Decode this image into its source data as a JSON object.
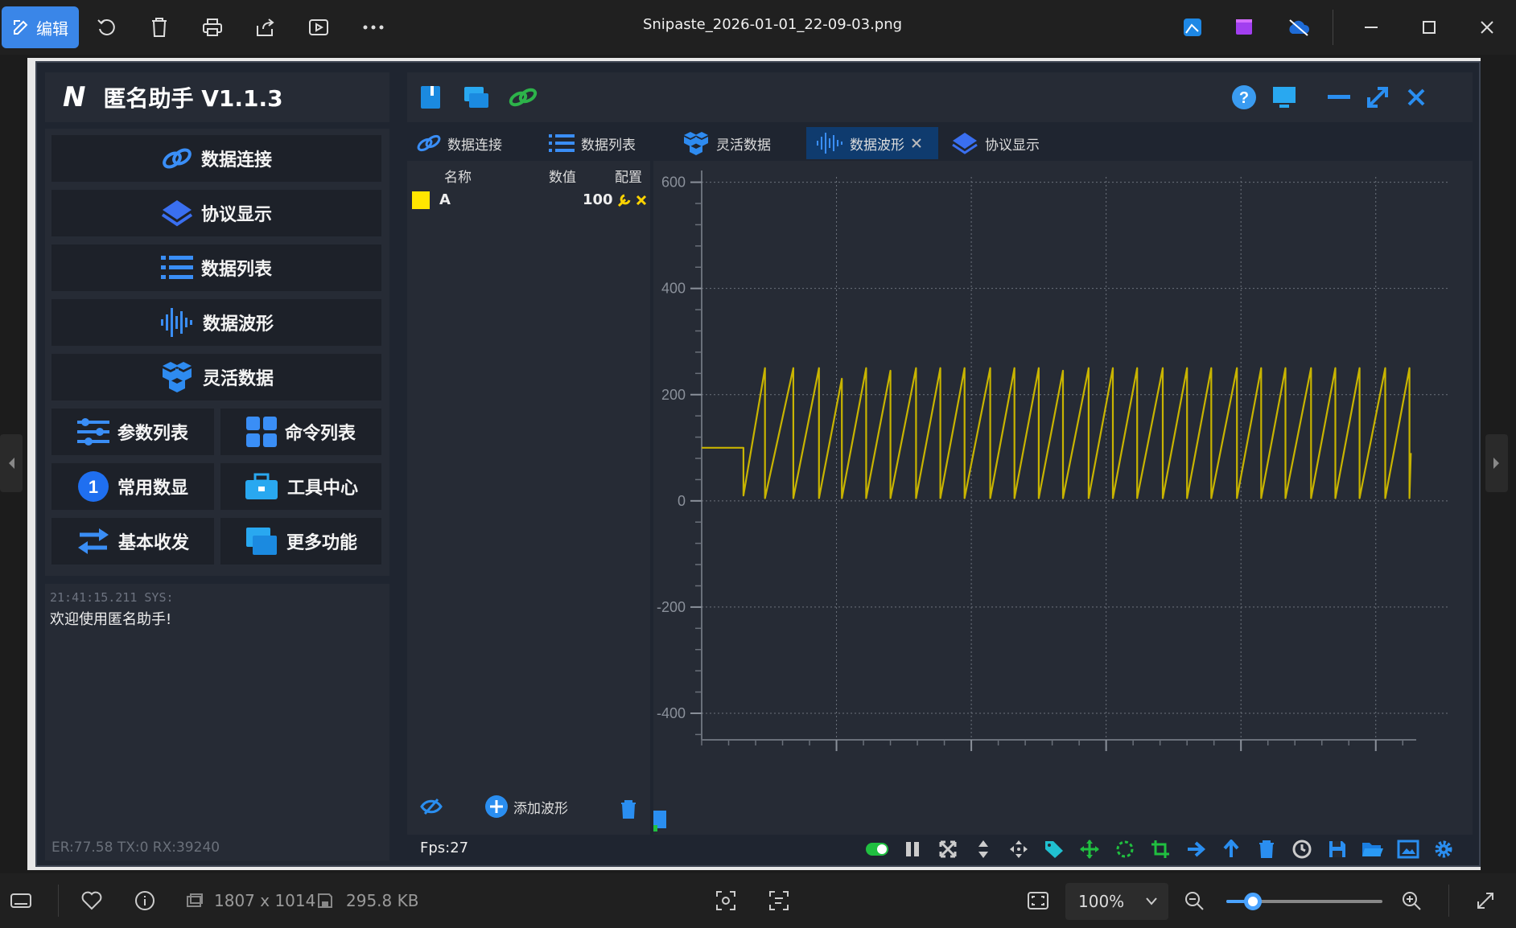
{
  "viewer": {
    "edit_label": "编辑",
    "filename": "Snipaste_2026-01-01_22-09-03.png",
    "dimensions": "1807 x 1014",
    "filesize": "295.8 KB",
    "zoom": "100%",
    "zoom_slider_fraction": 0.17,
    "accent": "#3a86e8"
  },
  "app": {
    "logo": "N",
    "title": "匿名助手  V1.1.3",
    "menu": {
      "connect": "数据连接",
      "protocol": "协议显示",
      "list": "数据列表",
      "wave": "数据波形",
      "flex": "灵活数据",
      "params": "参数列表",
      "commands": "命令列表",
      "common": "常用数显",
      "tools": "工具中心",
      "basic": "基本收发",
      "more": "更多功能"
    },
    "log": {
      "time": "21:41:15.211 SYS:",
      "message": "欢迎使用匿名助手!",
      "status": "ER:77.58 TX:0 RX:39240"
    },
    "tabs": [
      {
        "label": "数据连接"
      },
      {
        "label": "数据列表"
      },
      {
        "label": "灵活数据"
      },
      {
        "label": "数据波形"
      },
      {
        "label": "协议显示"
      }
    ],
    "list": {
      "col_name": "名称",
      "col_value": "数值",
      "col_config": "配置",
      "rows": [
        {
          "name": "A",
          "value": "100",
          "color": "#ffe600"
        }
      ],
      "add_wave": "添加波形"
    },
    "fps": "Fps:27"
  },
  "chart_data": {
    "type": "line",
    "series": [
      {
        "name": "A",
        "color": "#c8b400",
        "x": [
          0,
          31,
          31,
          47,
          47,
          68,
          68,
          87,
          87,
          104,
          104,
          122,
          122,
          140,
          140,
          159,
          159,
          177,
          177,
          195,
          195,
          214,
          214,
          232,
          232,
          250,
          250,
          268,
          268,
          287,
          287,
          305,
          305,
          323,
          323,
          342,
          342,
          360,
          360,
          378,
          378,
          397,
          397,
          415,
          415,
          433,
          433,
          452,
          452,
          470,
          470,
          488,
          488,
          507,
          507,
          525,
          525,
          526
        ],
        "y": [
          100,
          100,
          10,
          250,
          5,
          250,
          5,
          250,
          5,
          230,
          5,
          250,
          5,
          245,
          5,
          250,
          5,
          250,
          5,
          250,
          5,
          250,
          5,
          250,
          5,
          250,
          5,
          245,
          5,
          250,
          5,
          250,
          5,
          250,
          5,
          250,
          5,
          250,
          5,
          250,
          5,
          250,
          5,
          250,
          5,
          250,
          5,
          250,
          5,
          250,
          5,
          250,
          5,
          250,
          5,
          250,
          5,
          90
        ]
      }
    ],
    "xlim": [
      0,
      530
    ],
    "ylim": [
      -450,
      610
    ],
    "xticks": [
      100,
      200,
      300,
      400,
      500
    ],
    "yticks": [
      600,
      400,
      200,
      0,
      -200,
      -400
    ],
    "grid": true
  }
}
